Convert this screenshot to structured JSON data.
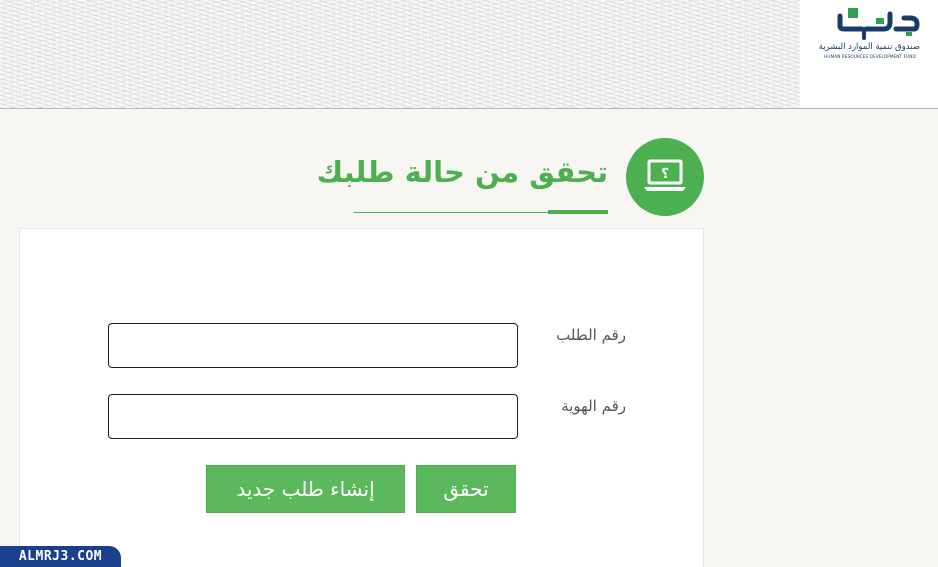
{
  "header": {
    "logo_caption_ar": "صندوق تنمية الموارد البشرية",
    "logo_caption_en": "HUMAN RESOURCES DEVELOPMENT FUND"
  },
  "section": {
    "title": "تحقق من حالة طلبك",
    "icon": "laptop-question-icon"
  },
  "form": {
    "request_number_label": "رقم الطلب",
    "request_number_value": "",
    "id_number_label": "رقم الهوية",
    "id_number_value": "",
    "verify_button": "تحقق",
    "new_request_button": "إنشاء طلب جديد"
  },
  "watermark": {
    "text": "ALMRJ3.COM"
  },
  "colors": {
    "accent_green": "#4caf50",
    "button_green": "#5cb85c",
    "logo_blue": "#1a3a6b",
    "logo_green": "#2e9e4f",
    "watermark_blue": "#1a3f8f"
  }
}
